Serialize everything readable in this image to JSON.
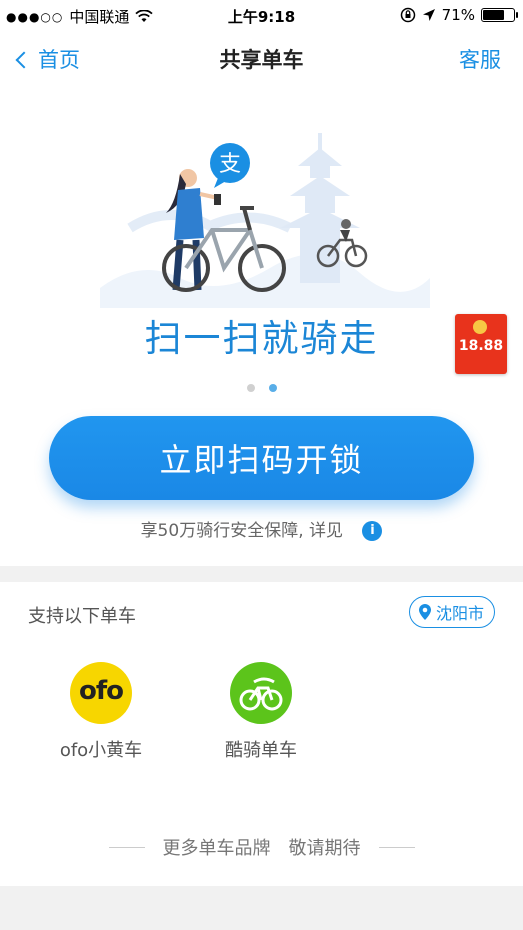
{
  "status_bar": {
    "carrier": "中国联通",
    "time": "上午9:18",
    "battery_percent": "71%",
    "battery_level": 0.71,
    "signal_icon": "signal-dots-icon",
    "wifi_icon": "wifi-icon",
    "lock_icon": "rotation-lock-icon",
    "location_icon": "location-arrow-icon"
  },
  "nav": {
    "back_label": "首页",
    "title": "共享单车",
    "right_label": "客服"
  },
  "hero": {
    "slogan": "扫一扫就骑走",
    "red_packet_amount": "18.88",
    "pager_total": 2,
    "pager_active": 2,
    "scan_button_label": "立即扫码开锁",
    "insurance_text": "享50万骑行安全保障, 详见"
  },
  "bikes": {
    "section_label": "支持以下单车",
    "city": "沈阳市",
    "brands": [
      {
        "name": "ofo小黄车",
        "logo_text": "ofo"
      },
      {
        "name": "酷骑单车"
      }
    ],
    "more_left": "更多单车品牌",
    "more_right": "敬请期待"
  },
  "colors": {
    "accent": "#1a8fe3",
    "ofo_yellow": "#f7d600",
    "kuqi_green": "#5cc41b",
    "red_packet": "#e8331c"
  }
}
